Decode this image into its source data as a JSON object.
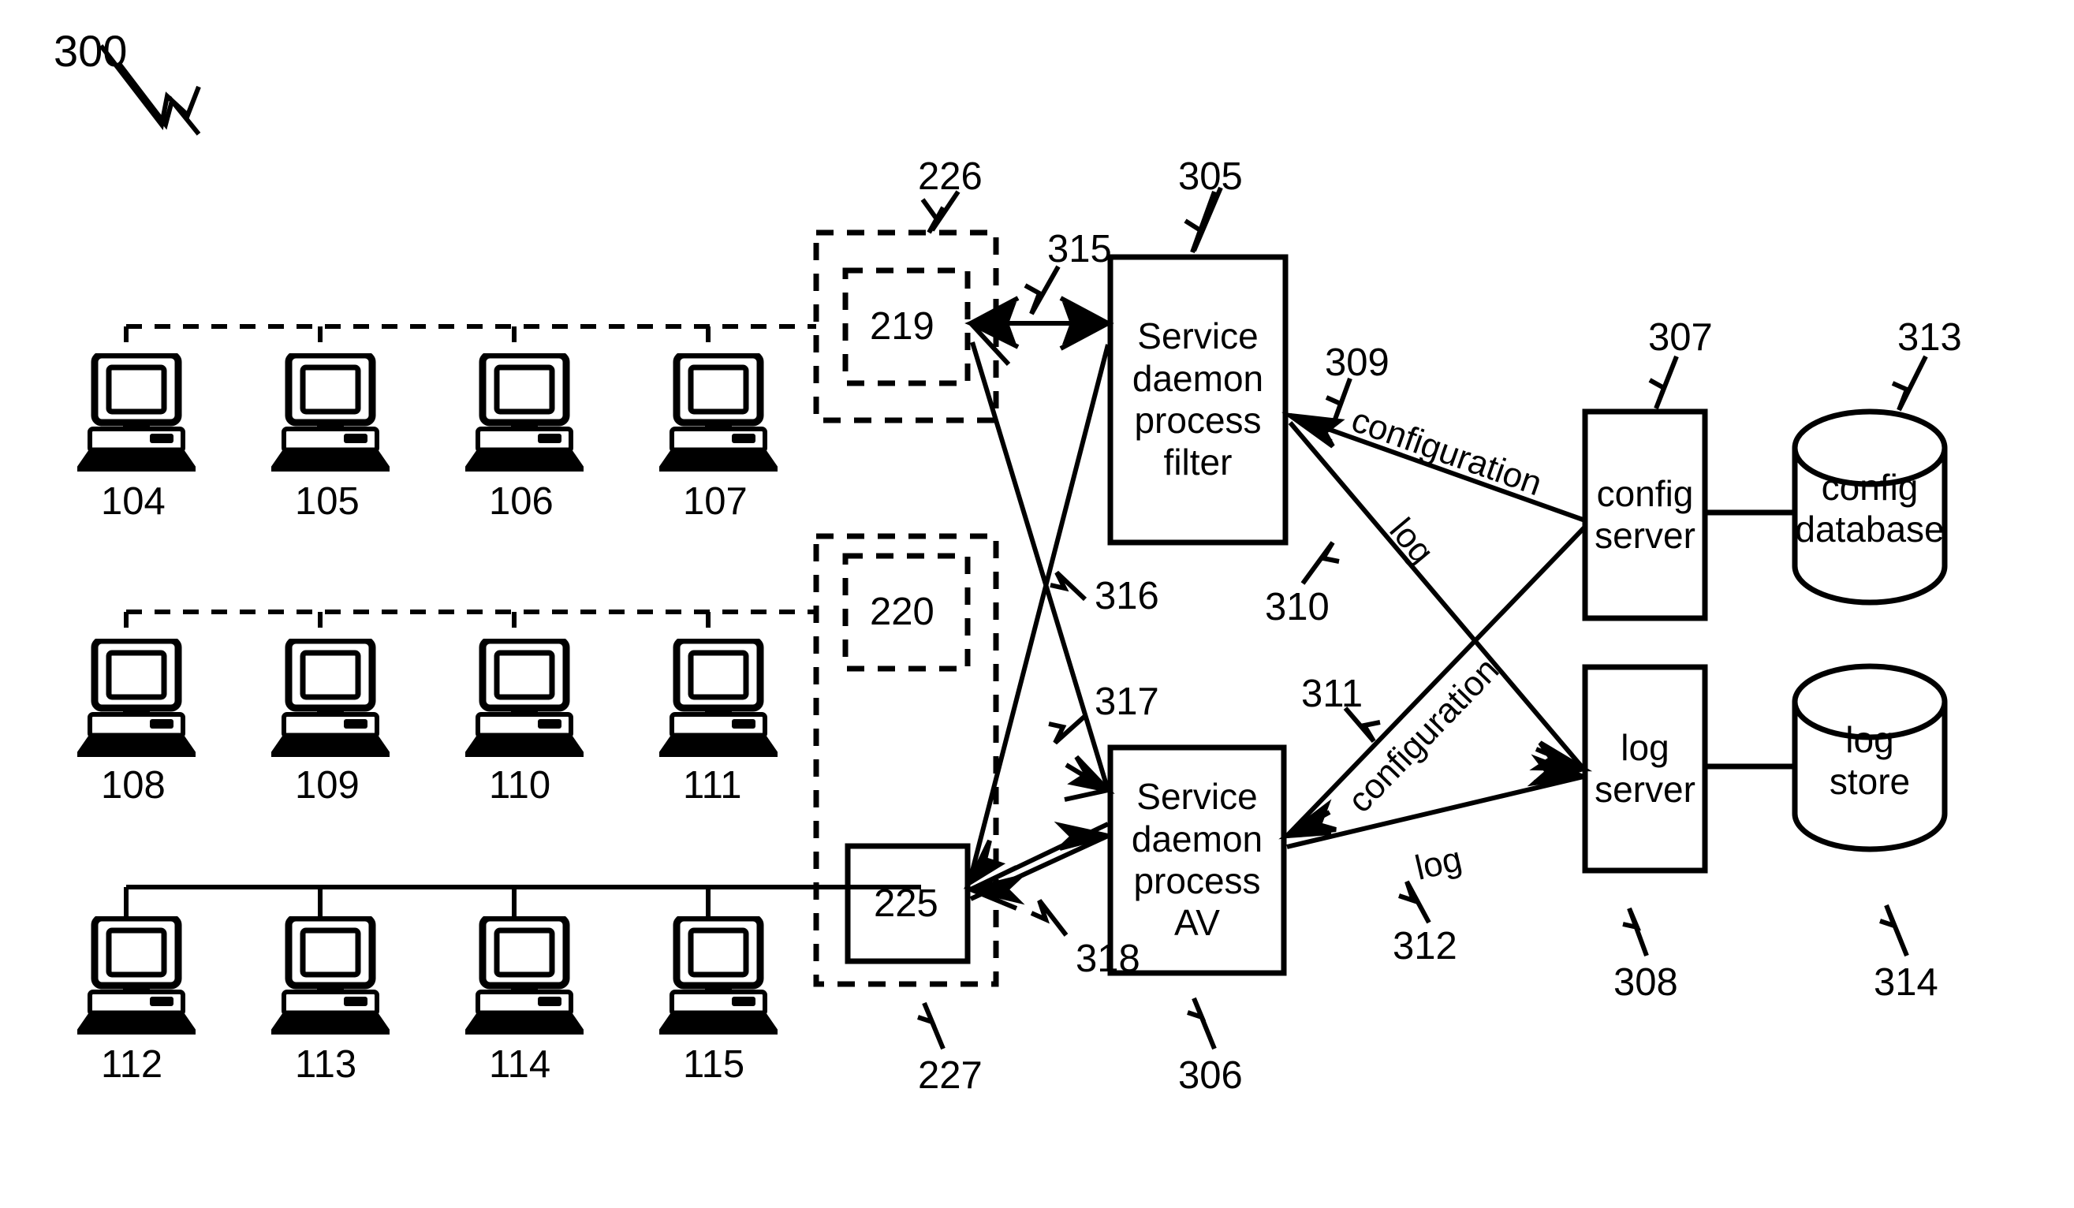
{
  "figure": {
    "id": "300",
    "type": "patent-system-diagram"
  },
  "clients": {
    "row1": [
      "104",
      "105",
      "106",
      "107"
    ],
    "row2": [
      "108",
      "109",
      "110",
      "111"
    ],
    "row3": [
      "112",
      "113",
      "114",
      "115"
    ]
  },
  "group_boxes": [
    {
      "ref": "226",
      "inner": "219"
    },
    {
      "ref": "227",
      "inner": "220",
      "solid": "225"
    }
  ],
  "nodes": {
    "n219": "219",
    "n220": "220",
    "n225": "225",
    "n226": "226",
    "n227": "227",
    "filter": {
      "ref": "305",
      "lines": [
        "Service",
        "daemon",
        "process",
        "filter"
      ]
    },
    "av": {
      "ref": "306",
      "lines": [
        "Service",
        "daemon",
        "process",
        "AV"
      ]
    },
    "config_server": {
      "ref": "307",
      "lines": [
        "config",
        "server"
      ]
    },
    "log_server": {
      "ref": "308",
      "lines": [
        "log",
        "server"
      ]
    },
    "config_database": {
      "ref": "313",
      "lines": [
        "config",
        "database"
      ]
    },
    "log_store": {
      "ref": "314",
      "lines": [
        "log",
        "store"
      ]
    }
  },
  "connections": {
    "c315": "315",
    "c316": "316",
    "c317": "317",
    "c318": "318",
    "c309": {
      "ref": "309",
      "label": "configuration"
    },
    "c310": {
      "ref": "310",
      "label": "log"
    },
    "c311": {
      "ref": "311",
      "label": "configuration"
    },
    "c312": {
      "ref": "312",
      "label": "log"
    }
  },
  "style": {
    "ink": "#000000",
    "paper": "#ffffff"
  }
}
